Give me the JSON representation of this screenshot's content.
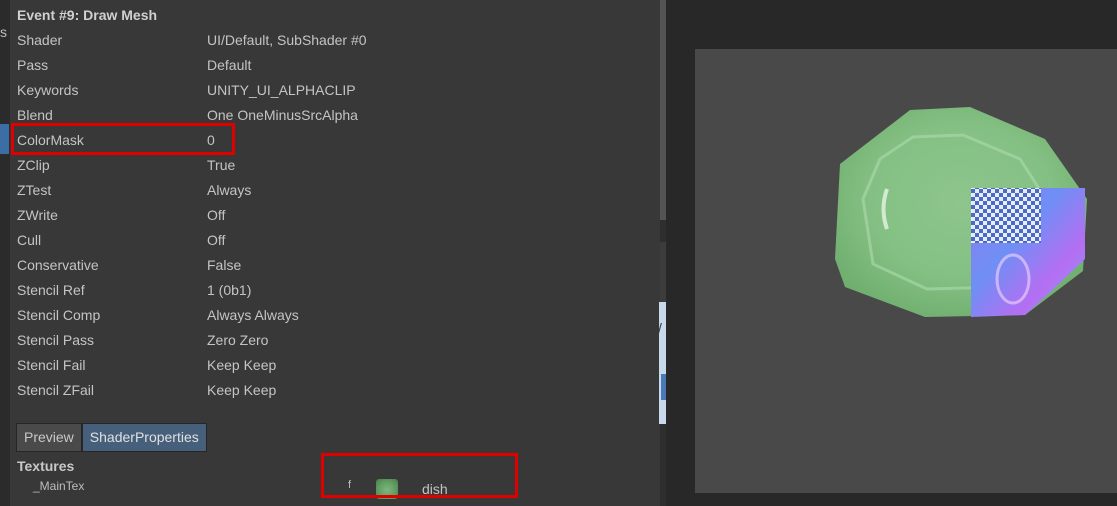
{
  "event": {
    "title": "Event #9: Draw Mesh"
  },
  "properties": [
    {
      "name": "Shader",
      "value": "UI/Default, SubShader #0"
    },
    {
      "name": "Pass",
      "value": "Default"
    },
    {
      "name": "Keywords",
      "value": "UNITY_UI_ALPHACLIP"
    },
    {
      "name": "Blend",
      "value": "One OneMinusSrcAlpha"
    },
    {
      "name": "ColorMask",
      "value": "0"
    },
    {
      "name": "ZClip",
      "value": "True"
    },
    {
      "name": "ZTest",
      "value": "Always"
    },
    {
      "name": "ZWrite",
      "value": "Off"
    },
    {
      "name": "Cull",
      "value": "Off"
    },
    {
      "name": "Conservative",
      "value": "False"
    },
    {
      "name": "Stencil Ref",
      "value": "1 (0b1)"
    },
    {
      "name": "Stencil Comp",
      "value": "Always Always"
    },
    {
      "name": "Stencil Pass",
      "value": "Zero Zero"
    },
    {
      "name": "Stencil Fail",
      "value": "Keep Keep"
    },
    {
      "name": "Stencil ZFail",
      "value": "Keep Keep"
    }
  ],
  "tabs": [
    {
      "label": "Preview",
      "active": false
    },
    {
      "label": "ShaderProperties",
      "active": true
    }
  ],
  "textures": {
    "section_title": "Textures",
    "rows": [
      {
        "name": "_MainTex",
        "flag": "f",
        "value": "dish"
      }
    ]
  },
  "gutter": {
    "fragment": "s"
  },
  "strip": {
    "fragment": "/"
  },
  "colors": {
    "highlight": "#e00000",
    "active_tab": "#46607c",
    "panel_bg": "#383838",
    "preview_bg": "#494949",
    "dish_green": "#8fc78f"
  },
  "icons": {
    "texture_thumbnail": "dish-thumbnail-icon"
  }
}
